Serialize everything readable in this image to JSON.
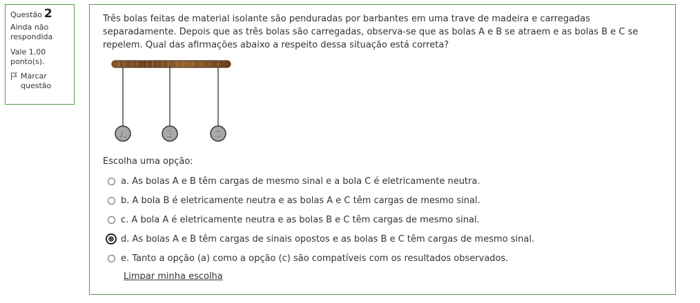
{
  "question_info": {
    "label": "Questão",
    "number": "2",
    "state": "Ainda não respondida",
    "grade": "Vale 1,00 ponto(s).",
    "flag_label": "Marcar questão"
  },
  "question": {
    "text": "Três bolas feitas de material isolante são penduradas por barbantes em uma trave de madeira e carregadas separadamente. Depois que as três bolas são carregadas, observa-se que as bolas A e B se atraem e as bolas B e C se repelem. Qual das afirmações abaixo a respeito dessa situação está correta?",
    "figure_balls": [
      "A",
      "B",
      "C"
    ],
    "prompt": "Escolha uma opção:"
  },
  "options": [
    {
      "text": "a. As bolas A e B têm cargas de mesmo sinal e a bola C é eletricamente neutra.",
      "selected": false
    },
    {
      "text": "b. A bola B é eletricamente neutra e as bolas A e C têm cargas de mesmo sinal.",
      "selected": false
    },
    {
      "text": "c. A bola A é eletricamente neutra e as bolas B e C têm cargas de mesmo sinal.",
      "selected": false
    },
    {
      "text": "d. As bolas A e B têm cargas de sinais opostos e as bolas B e C têm cargas de mesmo sinal.",
      "selected": true
    },
    {
      "text": "e. Tanto a opção (a) como a opção (c) são compatíveis com os resultados observados.",
      "selected": false
    }
  ],
  "clear_label": "Limpar minha escolha",
  "colors": {
    "border": "#4f9a3f",
    "wood": "#7a4a25",
    "ball": "#a8a8a8"
  }
}
